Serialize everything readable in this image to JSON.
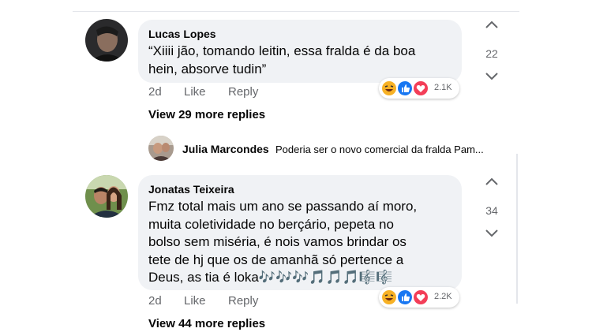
{
  "comments": [
    {
      "author": "Lucas Lopes",
      "lines": [
        "“Xiiii jão, tomando leitin, essa fralda é da boa",
        "hein, absorve tudin”"
      ],
      "time": "2d",
      "like": "Like",
      "reply": "Reply",
      "votes": "22",
      "reactions_count": "2.1K",
      "reaction_icons": [
        "haha-icon",
        "like-icon",
        "love-icon"
      ],
      "view_more": "View 29 more replies"
    },
    {
      "author": "Jonatas Teixeira",
      "lines": [
        "Fmz total mais um ano se passando aí moro,",
        "muita coletividade no berçário, pepeta no",
        "bolso sem miséria, é nois vamos brindar os",
        "tete de hj que os de amanhã só pertence a",
        "Deus, as tia é loka🎶🎶🎶🎵🎵🎵🎼🎼"
      ],
      "time": "2d",
      "like": "Like",
      "reply": "Reply",
      "votes": "34",
      "reactions_count": "2.2K",
      "reaction_icons": [
        "haha-icon",
        "like-icon",
        "love-icon"
      ],
      "view_more": "View 44 more replies"
    }
  ],
  "reply_preview": {
    "name": "Julia Marcondes",
    "text": "Poderia ser o novo comercial da fralda Pam..."
  },
  "colors": {
    "bubble": "#f0f2f5",
    "meta": "#65676b",
    "like": "#1877f2",
    "love": "#f33e58",
    "haha": "#f7b125"
  }
}
